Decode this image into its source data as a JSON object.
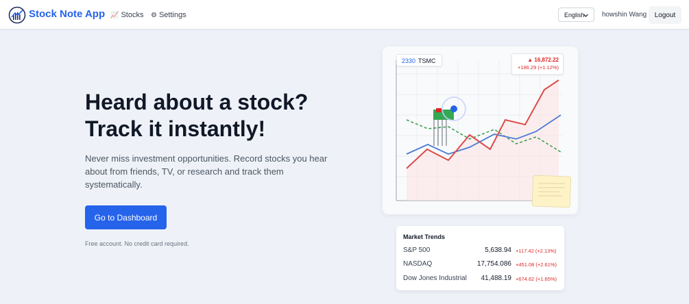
{
  "nav": {
    "brand": "Stock Note App",
    "links": [
      {
        "icon": "chart-icon",
        "glyph": "📈",
        "label": "Stocks"
      },
      {
        "icon": "gear-icon",
        "glyph": "⚙",
        "label": "Settings"
      }
    ],
    "language": "English",
    "user": "howshin Wang",
    "logout": "Logout"
  },
  "hero": {
    "title_line1": "Heard about a stock?",
    "title_line2": "Track it instantly!",
    "description": "Never miss investment opportunities. Record stocks you hear about from friends, TV, or research and track them systematically.",
    "cta": "Go to Dashboard",
    "note": "Free account. No credit card required."
  },
  "illustration": {
    "ticker_code": "2330",
    "ticker_name": "TSMC",
    "price": "▲ 16,872.22",
    "change": "+186.29 (+1.12%)",
    "colors": {
      "red": "#dc4a4a",
      "blue": "#4a7bd4",
      "green": "#3f9e55",
      "accent": "#2563eb"
    }
  },
  "market_trends": {
    "title": "Market Trends",
    "rows": [
      {
        "name": "S&P 500",
        "value": "5,638.94",
        "change": "+117.42 (+2.13%)"
      },
      {
        "name": "NASDAQ",
        "value": "17,754.086",
        "change": "+451.08 (+2.61%)"
      },
      {
        "name": "Dow Jones Industrial",
        "value": "41,488.19",
        "change": "+674.62 (+1.65%)"
      }
    ]
  }
}
